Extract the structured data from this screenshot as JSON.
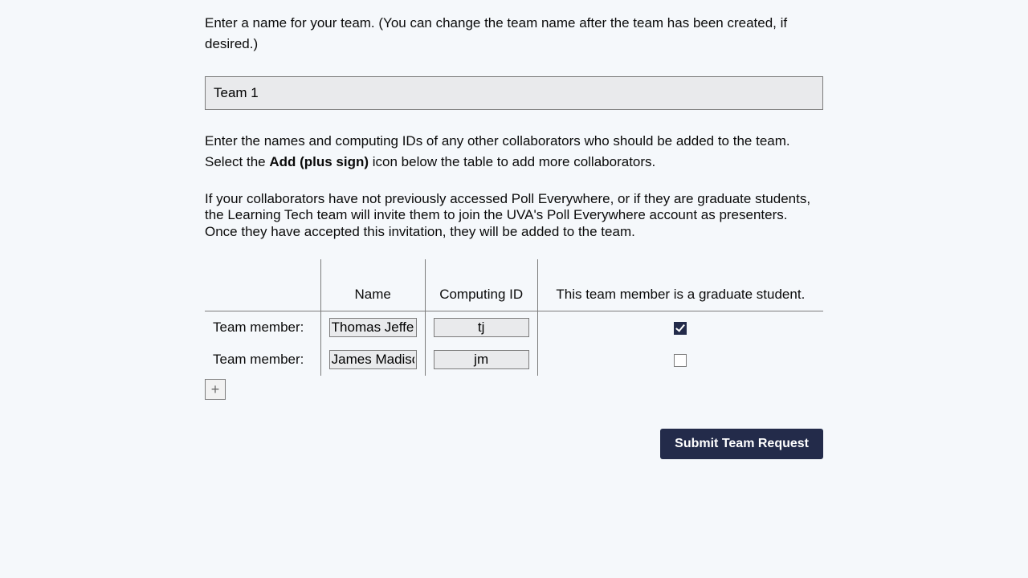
{
  "instructions": {
    "team_name": "Enter a name for your team. (You can change the team name after the team has been created, if desired.)",
    "collaborators_1a": "Enter the names and computing IDs of any other collaborators who should be added to the team. Select the ",
    "collaborators_1b_bold": "Add (plus sign)",
    "collaborators_1c": " icon below the table to add more collaborators.",
    "collaborators_2": "If your collaborators have not previously accessed Poll Everywhere, or if they are graduate students, the Learning Tech team will invite them to join the UVA's Poll Everywhere account as presenters. Once they have accepted this invitation, they will be added to the team."
  },
  "team_name_value": "Team 1",
  "table": {
    "row_label": "Team member:",
    "headers": {
      "name": "Name",
      "computing_id": "Computing ID",
      "grad": "This team member is a graduate student."
    },
    "rows": [
      {
        "name": "Thomas Jefferson",
        "computing_id": "tj",
        "grad": true
      },
      {
        "name": "James Madison",
        "computing_id": "jm",
        "grad": false
      }
    ]
  },
  "buttons": {
    "add_icon": "+",
    "submit": "Submit Team Request"
  }
}
